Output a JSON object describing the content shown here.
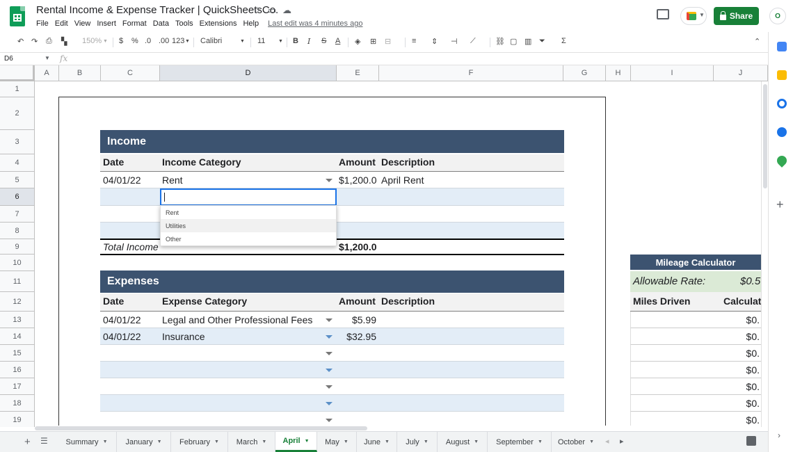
{
  "app": {
    "title": "Rental Income & Expense Tracker | QuickSheetsCo.",
    "menu": [
      "File",
      "Edit",
      "View",
      "Insert",
      "Format",
      "Data",
      "Tools",
      "Extensions",
      "Help"
    ],
    "last_edit": "Last edit was 4 minutes ago",
    "share_label": "Share",
    "avatar_label": "O"
  },
  "toolbar": {
    "zoom": "150%",
    "currency": "$",
    "percent": "%",
    "dec_decrease": ".0",
    "dec_increase": ".00",
    "more_formats": "123",
    "font": "Calibri",
    "font_size": "11",
    "bold": "B",
    "italic": "I",
    "strike": "S",
    "text_color": "A",
    "sum": "Σ"
  },
  "formula_bar": {
    "name_box": "D6",
    "fx": "fx"
  },
  "columns": [
    "A",
    "B",
    "C",
    "D",
    "E",
    "F",
    "G",
    "H",
    "I",
    "J"
  ],
  "rows": [
    "1",
    "2",
    "3",
    "4",
    "5",
    "6",
    "7",
    "8",
    "9",
    "10",
    "11",
    "12",
    "13",
    "14",
    "15",
    "16",
    "17",
    "18",
    "19"
  ],
  "income": {
    "title": "Income",
    "headers": {
      "date": "Date",
      "category": "Income Category",
      "amount": "Amount",
      "description": "Description"
    },
    "rows": [
      {
        "date": "04/01/22",
        "category": "Rent",
        "amount": "$1,200.0",
        "description": "April Rent"
      }
    ],
    "total_label": "Total Income",
    "total_value": "$1,200.0"
  },
  "dropdown": {
    "options": [
      "Rent",
      "Utilities",
      "Other"
    ],
    "hovered": "Utilities"
  },
  "expenses": {
    "title": "Expenses",
    "headers": {
      "date": "Date",
      "category": "Expense Category",
      "amount": "Amount",
      "description": "Description"
    },
    "rows": [
      {
        "date": "04/01/22",
        "category": "Legal and Other Professional Fees",
        "amount": "$5.99"
      },
      {
        "date": "04/01/22",
        "category": "Insurance",
        "amount": "$32.95"
      }
    ]
  },
  "mileage": {
    "title": "Mileage Calculator",
    "rate_label": "Allowable Rate:",
    "rate_value": "$0.5",
    "miles_header": "Miles Driven",
    "calc_header": "Calculat",
    "calc_values": [
      "$0.",
      "$0.",
      "$0.",
      "$0.",
      "$0.",
      "$0.",
      "$0."
    ]
  },
  "tabs": [
    "Summary",
    "January",
    "February",
    "March",
    "April",
    "May",
    "June",
    "July",
    "August",
    "September",
    "October"
  ],
  "active_tab": "April",
  "colors": {
    "header_blue": "#3c5370",
    "band_blue": "#e3edf7",
    "accent_green": "#188038",
    "selection_blue": "#1a73e8",
    "rate_green": "#dbead6"
  }
}
